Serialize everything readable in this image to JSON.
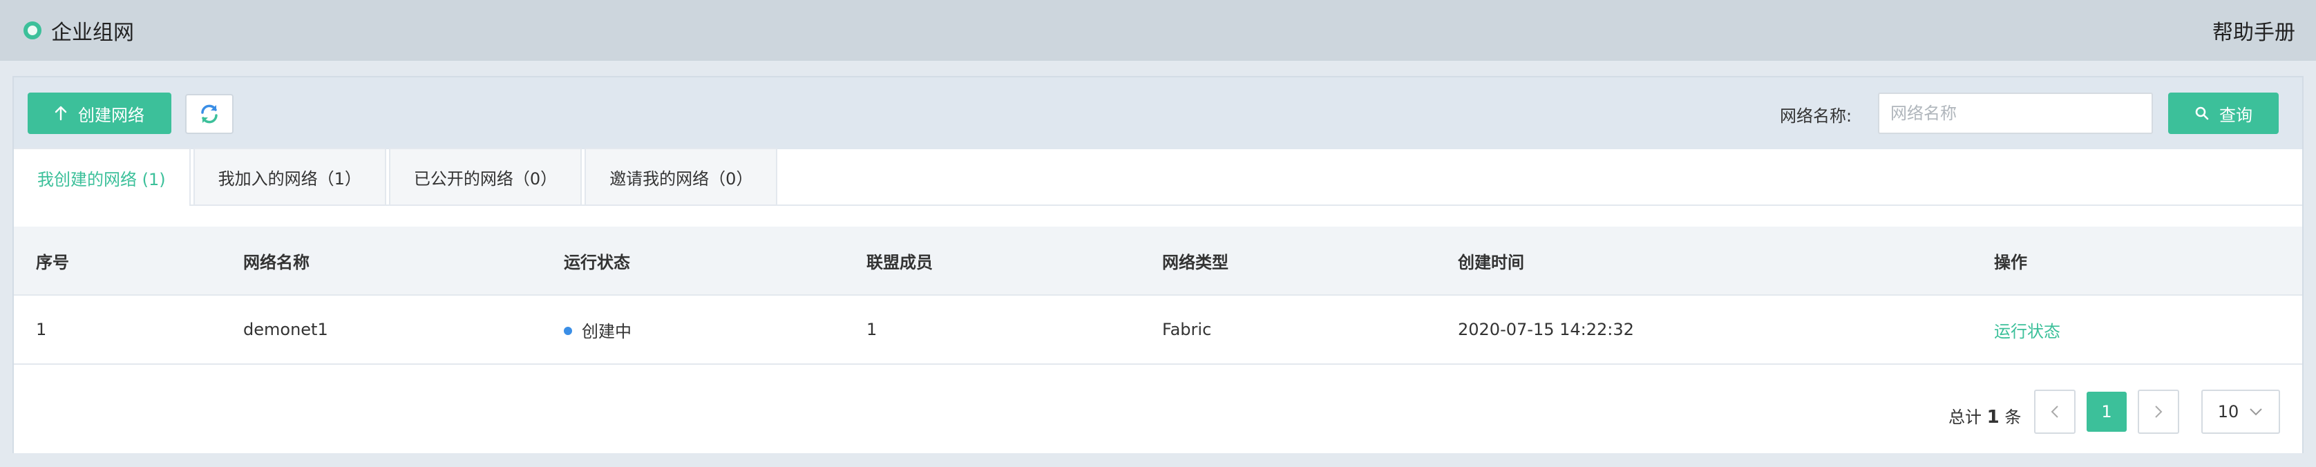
{
  "header": {
    "title": "企业组网",
    "help_label": "帮助手册",
    "brand_icon": "circle-logo-icon"
  },
  "toolbar": {
    "create_label": "创建网络",
    "create_icon": "arrow-up-icon",
    "refresh_icon": "refresh-icon",
    "search_label": "网络名称:",
    "search_placeholder": "网络名称",
    "search_value": "",
    "search_button_label": "查询",
    "search_icon": "search-icon"
  },
  "tabs": [
    {
      "label": "我创建的网络 (1)",
      "active": true
    },
    {
      "label": "我加入的网络（1）",
      "active": false
    },
    {
      "label": "已公开的网络（0）",
      "active": false
    },
    {
      "label": "邀请我的网络（0）",
      "active": false
    }
  ],
  "table": {
    "columns": [
      "序号",
      "网络名称",
      "运行状态",
      "联盟成员",
      "网络类型",
      "创建时间",
      "操作"
    ],
    "rows": [
      {
        "index": "1",
        "name": "demonet1",
        "status": "创建中",
        "members": "1",
        "type": "Fabric",
        "created": "2020-07-15 14:22:32",
        "action": "运行状态"
      }
    ]
  },
  "pagination": {
    "total_prefix": "总计",
    "total_count": "1",
    "total_suffix": "条",
    "current_page": "1",
    "page_size": "10"
  },
  "colors": {
    "accent": "#3cc09a",
    "status_creating": "#3a8ee6"
  }
}
